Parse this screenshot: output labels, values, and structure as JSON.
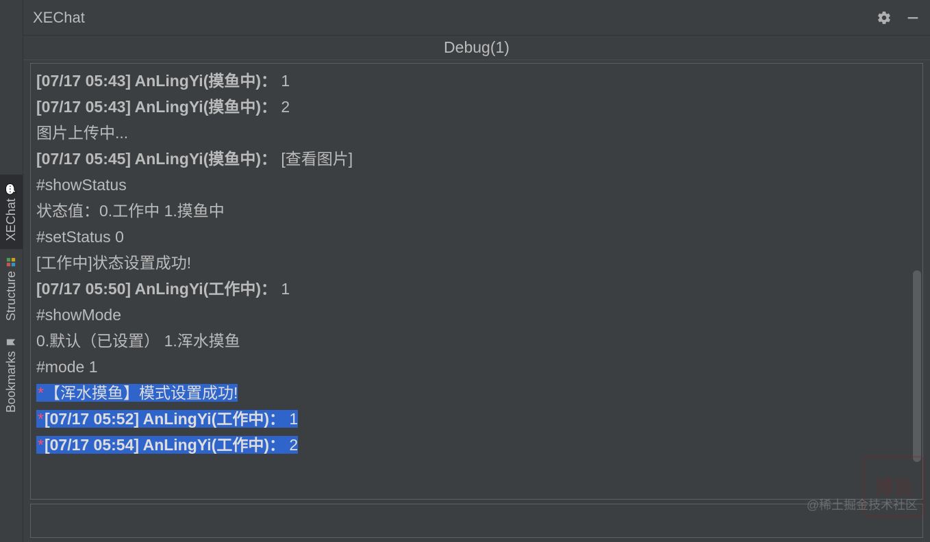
{
  "title": "XEChat",
  "tab": "Debug(1)",
  "sidebar": {
    "items": [
      {
        "label": "XEChat",
        "active": true
      },
      {
        "label": "Structure",
        "active": false
      },
      {
        "label": "Bookmarks",
        "active": false
      }
    ]
  },
  "watermark": "@稀土掘金技术社区",
  "messages": [
    {
      "type": "msg",
      "ts": "[07/17 05:43]",
      "user": "AnLingYi(摸鱼中)：",
      "text": "1"
    },
    {
      "type": "msg",
      "ts": "[07/17 05:43]",
      "user": "AnLingYi(摸鱼中)：",
      "text": "2"
    },
    {
      "type": "plain",
      "text": "图片上传中..."
    },
    {
      "type": "msg",
      "ts": "[07/17 05:45]",
      "user": "AnLingYi(摸鱼中)：",
      "text": "[查看图片]",
      "link": true
    },
    {
      "type": "plain",
      "text": "#showStatus"
    },
    {
      "type": "plain",
      "text": "状态值：0.工作中 1.摸鱼中"
    },
    {
      "type": "plain",
      "text": "#setStatus 0"
    },
    {
      "type": "plain",
      "text": "[工作中]状态设置成功!"
    },
    {
      "type": "msg",
      "ts": "[07/17 05:50]",
      "user": "AnLingYi(工作中)：",
      "text": "1"
    },
    {
      "type": "plain",
      "text": "#showMode"
    },
    {
      "type": "plain",
      "text": "0.默认（已设置） 1.浑水摸鱼"
    },
    {
      "type": "plain",
      "text": "#mode 1"
    },
    {
      "type": "hl_plain",
      "star": "*",
      "text": "【浑水摸鱼】模式设置成功!"
    },
    {
      "type": "hl_msg",
      "star": "*",
      "ts": "[07/17 05:52]",
      "user": "AnLingYi(工作中)：",
      "text": "1"
    },
    {
      "type": "hl_msg",
      "star": "*",
      "ts": "[07/17 05:54]",
      "user": "AnLingYi(工作中)：",
      "text": "2"
    }
  ],
  "input": {
    "value": ""
  }
}
